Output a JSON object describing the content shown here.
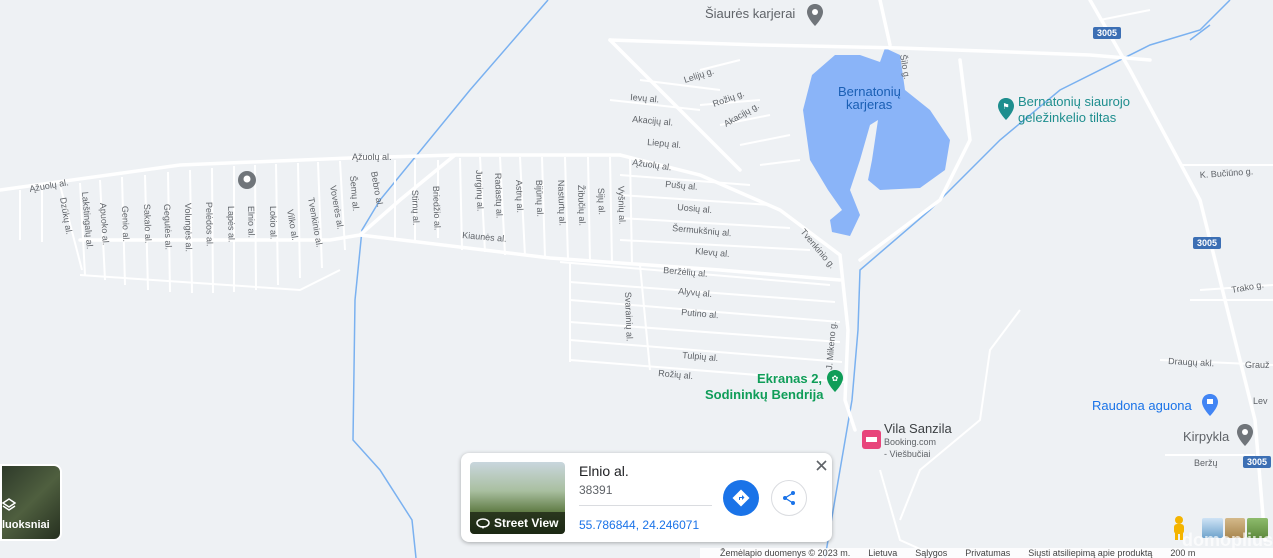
{
  "map": {
    "water_color": "#8ab4f8",
    "river_color": "#7ab1f0",
    "road_color": "#ffffff",
    "poi_green": "#0f9d58",
    "poi_teal": "#1e8e8e",
    "poi_pink": "#e8457b",
    "route_badge_color": "#3c6fb4",
    "places": {
      "siaures_karjerai": "Šiaurės karjerai",
      "bernatoniu_line1": "Bernatonių",
      "bernatoniu_line2": "karjeras",
      "bridge_line1": "Bernatonių siaurojo",
      "bridge_line2": "geležinkelio tiltas",
      "ekranas_line1": "Ekranas 2,",
      "ekranas_line2": "Sodininkų Bendrija",
      "vila": "Vila Sanzila",
      "vila_sub1": "Booking.com",
      "vila_sub2": "- Viešbučiai",
      "raudona": "Raudona aguona",
      "kirpykla": "Kirpykla"
    },
    "routes": {
      "r1": "3005",
      "r2": "3005",
      "r3": "3005"
    },
    "streets": {
      "azuolu_left": "Ąžuolų al.",
      "azuolu_top": "Ąžuolų al.",
      "azuolu_right": "Ąžuolų al.",
      "dzuku": "Dzūkų al.",
      "laksting": "Lakštingalų al.",
      "apuoko": "Apuoko al.",
      "genio": "Genio al.",
      "sakalo": "Sakalo al.",
      "geguzes": "Gegutės al.",
      "volunges": "Volungės al.",
      "peledos": "Pelėdos al.",
      "lapes": "Lapės al.",
      "elnio": "Elnio al.",
      "lokio": "Lokio al.",
      "vilko": "Vilko al.",
      "tvenkinio": "Tvenkinio al.",
      "vovere": "Voverės al.",
      "semu": "Šemų al.",
      "bebro": "Bebro al.",
      "stirnu": "Stirnų al.",
      "briedzio": "Briedžio al.",
      "jurginu": "Jurginų al.",
      "radastu": "Radastų al.",
      "astru": "Astrų al.",
      "bijunu": "Bijūnų al.",
      "nasturtu": "Nasturtų al.",
      "zibuciu": "Žibučių al.",
      "sinu": "Sijų al.",
      "vysniu": "Vyšnių al.",
      "kiaunes": "Kiaunės al.",
      "leliju": "Lelijų g.",
      "roziu": "Rožių g.",
      "akaciju_g": "Akacijų g.",
      "ievu": "Ievų al.",
      "akaciju": "Akacijų al.",
      "liepu": "Liepų al.",
      "pusu": "Pušų al.",
      "uosiu": "Uosių al.",
      "sermuksniu": "Šermukšnių al.",
      "klevu": "Klevų al.",
      "berzeliu": "Beržėlių al.",
      "alyvu": "Alyvų al.",
      "putino": "Putino al.",
      "tulpiu": "Tulpių al.",
      "roziu_al": "Rožių al.",
      "svarainiu": "Svarainių al.",
      "mikeno": "J. Mikeno g.",
      "tvenkinio_g": "Tvenkinio g.",
      "silo": "Šilo g.",
      "k_buciuno": "K. Bučiūno g.",
      "trako": "Trako g.",
      "draugu": "Draugų akl.",
      "grauz": "Grauž",
      "beržu": "Beržų",
      "lev": "Lev"
    }
  },
  "info_card": {
    "title": "Elnio al.",
    "postal_code": "38391",
    "coordinates": "55.786844, 24.246071",
    "street_view_label": "Street View",
    "directions_icon": "directions-icon",
    "share_icon": "share-icon",
    "close_icon": "close-icon"
  },
  "layers_button": {
    "label": "luoksniai"
  },
  "footer": {
    "map_data": "Žemėlapio duomenys ©  2023 m.",
    "lithuania": "Lietuva",
    "terms": "Sąlygos",
    "privacy": "Privatumas",
    "feedback": "Siųsti atsiliepimą apie produktą",
    "scale": "200 m"
  },
  "watermark": "domoplius"
}
